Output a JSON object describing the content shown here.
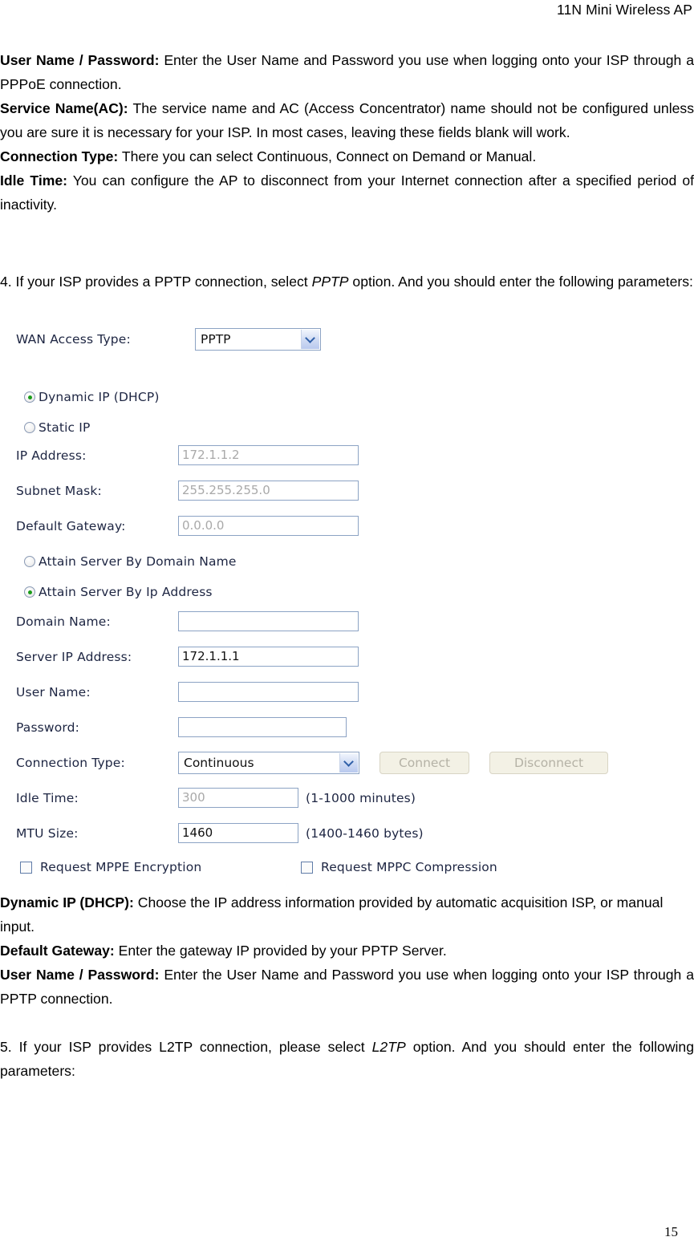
{
  "header": {
    "title": "11N Mini Wireless AP"
  },
  "definitions_pppoe": [
    {
      "term": "User Name / Password:",
      "text": " Enter the User Name and Password you use when logging onto your ISP through a PPPoE connection."
    },
    {
      "term": "Service Name(AC):",
      "text": " The service name and AC (Access Concentrator) name should not be configured unless you are sure it is necessary for your ISP. In most cases, leaving these fields blank will work."
    },
    {
      "term": "Connection Type:",
      "text": " There you can select Continuous, Connect on Demand or Manual."
    },
    {
      "term": "Idle Time:",
      "text": " You can configure the AP to disconnect from your Internet connection after a specified period of inactivity."
    }
  ],
  "para_4": {
    "part1": "4. If your ISP provides a PPTP connection, select ",
    "emphasis": "PPTP",
    "part2": " option. And you should enter the following parameters:"
  },
  "form": {
    "wan_access_type": {
      "label": "WAN Access Type:",
      "value": "PPTP"
    },
    "ip_mode_radios": [
      {
        "label": "Dynamic IP (DHCP)",
        "selected": true
      },
      {
        "label": "Static IP",
        "selected": false
      }
    ],
    "static_fields": [
      {
        "label": "IP Address:",
        "value": "172.1.1.2",
        "disabled": true
      },
      {
        "label": "Subnet Mask:",
        "value": "255.255.255.0",
        "disabled": true
      },
      {
        "label": "Default Gateway:",
        "value": "0.0.0.0",
        "disabled": true
      }
    ],
    "server_mode_radios": [
      {
        "label": "Attain Server By Domain Name",
        "selected": false
      },
      {
        "label": "Attain Server By Ip Address",
        "selected": true
      }
    ],
    "server_fields": [
      {
        "label": "Domain Name:",
        "value": "",
        "disabled": false
      },
      {
        "label": "Server IP Address:",
        "value": "172.1.1.1",
        "disabled": false
      },
      {
        "label": "User Name:",
        "value": "",
        "disabled": false
      },
      {
        "label": "Password:",
        "value": "",
        "disabled": false
      }
    ],
    "connection_type": {
      "label": "Connection Type:",
      "value": "Continuous",
      "connect_button": "Connect",
      "disconnect_button": "Disconnect"
    },
    "idle_time": {
      "label": "Idle Time:",
      "value": "300",
      "hint": "(1-1000 minutes)"
    },
    "mtu_size": {
      "label": "MTU Size:",
      "value": "1460",
      "hint": "(1400-1460 bytes)"
    },
    "checkboxes": [
      {
        "label": "Request MPPE Encryption",
        "checked": false
      },
      {
        "label": "Request MPPC Compression",
        "checked": false
      }
    ]
  },
  "definitions_pptp": [
    {
      "term": "Dynamic IP (DHCP):",
      "text": " Choose the IP address information provided by automatic acquisition ISP, or manual input."
    },
    {
      "term": "Default Gateway:",
      "text": " Enter the gateway IP provided by your PPTP Server."
    },
    {
      "term": "User Name / Password:",
      "text": " Enter the User Name and Password you use when logging onto your ISP through a PPTP connection."
    }
  ],
  "para_5": {
    "part1": "5. If your ISP provides L2TP connection, please select ",
    "emphasis": "L2TP",
    "part2": " option. And you should enter the following parameters:"
  },
  "page_number": "15"
}
